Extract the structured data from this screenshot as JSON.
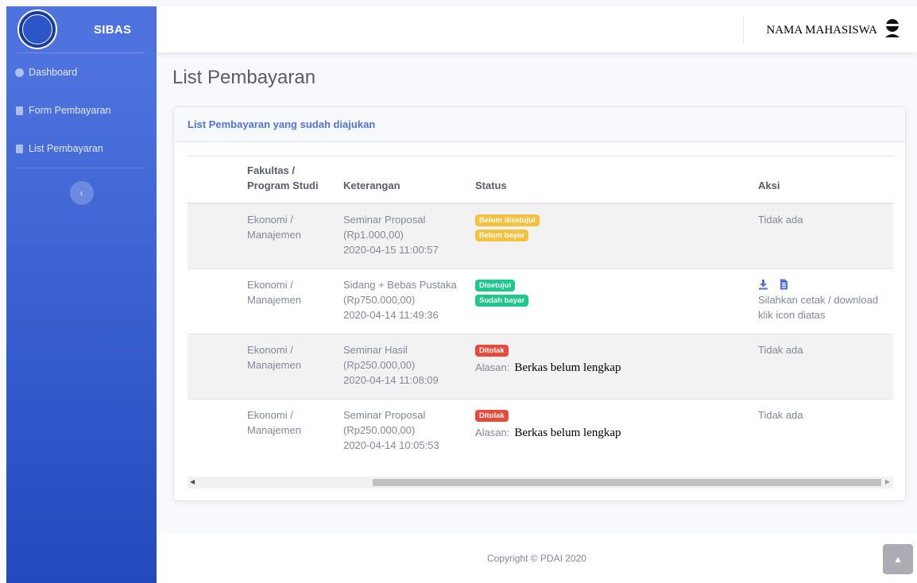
{
  "sidebar": {
    "brand": "SIBAS",
    "items": [
      {
        "label": "Dashboard",
        "icon": "dashboard-icon"
      },
      {
        "label": "Form Pembayaran",
        "icon": "file-icon"
      },
      {
        "label": "List Pembayaran",
        "icon": "file-icon"
      }
    ],
    "toggle_icon": "‹"
  },
  "topbar": {
    "user_name": "NAMA MAHASISWA"
  },
  "page": {
    "title": "List Pembayaran"
  },
  "card": {
    "title": "List Pembayaran yang sudah diajukan",
    "columns": [
      "",
      "Fakultas / Program Studi",
      "Keterangan",
      "Status",
      "Aksi"
    ],
    "rows": [
      {
        "fakultas": "Ekonomi /",
        "prodi": "Manajemen",
        "ket1": "Seminar Proposal",
        "ket2": "(Rp1.000,00)",
        "ket3": "2020-04-15 11:00:57",
        "badge1": "Belum disetujui",
        "badge2": "Belum bayar",
        "aksi": "Tidak ada"
      },
      {
        "fakultas": "Ekonomi /",
        "prodi": "Manajemen",
        "ket1": "Sidang + Bebas Pustaka",
        "ket2": "(Rp750.000,00)",
        "ket3": "2020-04-14 11:49:36",
        "badge1": "Disetujui",
        "badge2": "Sudah bayar",
        "aksi1": "Silahkan cetak / download",
        "aksi2": "klik icon diatas"
      },
      {
        "fakultas": "Ekonomi /",
        "prodi": "Manajemen",
        "ket1": "Seminar Hasil",
        "ket2": "(Rp250.000,00)",
        "ket3": "2020-04-14 11:08:09",
        "badge1": "Ditolak",
        "alasan_label": "Alasan:",
        "alasan": "Berkas belum lengkap",
        "aksi": "Tidak ada"
      },
      {
        "fakultas": "Ekonomi /",
        "prodi": "Manajemen",
        "ket1": "Seminar Proposal",
        "ket2": "(Rp250.000,00)",
        "ket3": "2020-04-14 10:05:53",
        "badge1": "Ditolak",
        "alasan_label": "Alasan:",
        "alasan": "Berkas belum lengkap",
        "aksi": "Tidak ada"
      }
    ]
  },
  "footer": {
    "copyright": "Copyright © PDAI 2020"
  },
  "colors": {
    "primary": "#4e73df",
    "warning": "#f6c23e",
    "success": "#1cc88a",
    "danger": "#e74a3b"
  }
}
